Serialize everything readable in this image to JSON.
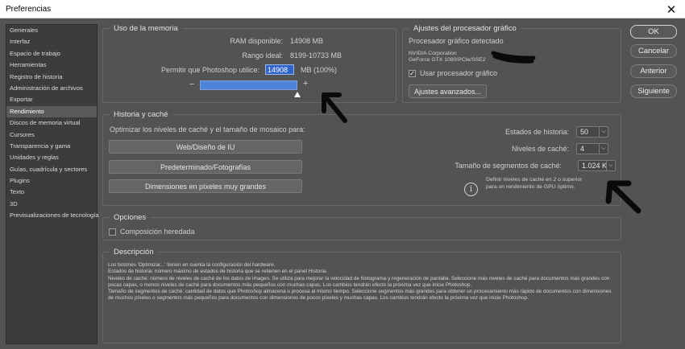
{
  "window": {
    "title": "Preferencias",
    "close": "✕"
  },
  "nav": {
    "items": [
      "Generales",
      "Interfaz",
      "Espacio de trabajo",
      "Herramientas",
      "Registro de historia",
      "Administración de archivos",
      "Exportar",
      "Rendimiento",
      "Discos de memoria virtual",
      "Cursores",
      "Transparencia y gama",
      "Unidades y reglas",
      "Guías, cuadrícula y sectores",
      "Plugins",
      "Texto",
      "3D",
      "Previsualizaciones de tecnología"
    ],
    "active": "Rendimiento"
  },
  "memory": {
    "title": "Uso de la memoria",
    "ram_label": "RAM disponible:",
    "ram_value": "14908 MB",
    "ideal_label": "Rango ideal:",
    "ideal_value": "8199-10733 MB",
    "allow_label": "Permitir que Photoshop utilice:",
    "allow_value": "14908",
    "allow_suffix": "MB (100%)",
    "slider_fraction": 1.0,
    "minus": "−",
    "plus": "+"
  },
  "gpu": {
    "title": "Ajustes del procesador gráfico",
    "detected_label": "Procesador gráfico detectado",
    "vendor": "NVIDIA Corporation",
    "model": "GeForce GTX 1080/PCIe/SSE2",
    "use_gpu_label": "Usar procesador gráfico",
    "use_gpu_checked": true,
    "advanced_button": "Ajustes avanzados..."
  },
  "history": {
    "title": "Historia y caché",
    "optimize_label": "Optimizar los niveles de caché y el tamaño de mosaico para:",
    "buttons": [
      "Web/Diseño de IU",
      "Predeterminado/Fotografías",
      "Dimensiones en píxeles muy grandes"
    ],
    "states_label": "Estados de historia:",
    "states_value": "50",
    "levels_label": "Niveles de caché:",
    "levels_value": "4",
    "tile_label": "Tamaño de segmentos de caché:",
    "tile_value": "1.024 K",
    "info_text": "Definir niveles de caché en 2 o superior para un rendimiento de GPU óptimo."
  },
  "options": {
    "title": "Opciones",
    "legacy_label": "Composición heredada",
    "legacy_checked": false
  },
  "description": {
    "title": "Descripción",
    "lines": [
      "Los botones 'Optimizar...' tienen en cuenta la configuración del hardware.",
      "Estados de historia: número máximo de estados de historia que se retienen en el panel Historia.",
      "Niveles de caché: número de niveles de caché de los datos de imagen. Se utiliza para mejorar la velocidad de histograma y regeneración de pantalla. Seleccione más niveles de caché para documentos más grandes con pocas capas, o menos niveles de caché para documentos más pequeños con muchas capas. Los cambios tendrán efecto la próxima vez que inicie Photoshop.",
      "Tamaño de segmentos de caché: cantidad de datos que Photoshop almacena o procesa al mismo tiempo. Seleccione segmentos más grandes para obtener un procesamiento más rápido de documentos con dimensiones de muchos píxeles o segmentos más pequeños para documentos con dimensiones de pocos píxeles y muchas capas. Los cambios tendrán efecto la próxima vez que inicie Photoshop."
    ]
  },
  "actions": {
    "ok": "OK",
    "cancel": "Cancelar",
    "prev": "Anterior",
    "next": "Siguiente"
  },
  "colors": {
    "background": "#535353",
    "accent": "#4d83d8",
    "titlebar": "#ffffff"
  }
}
